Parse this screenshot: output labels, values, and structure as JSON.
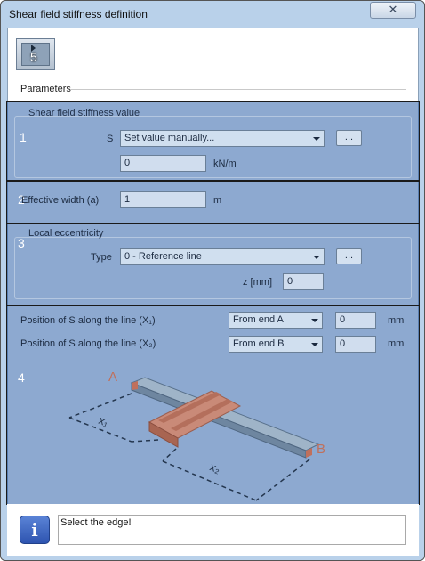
{
  "window": {
    "title": "Shear field stiffness definition",
    "close_glyph": "✕"
  },
  "toolbar": {
    "select_icon": "cursor-arrow-icon",
    "overlay_number": "5"
  },
  "parameters": {
    "label": "Parameters"
  },
  "stiffness": {
    "number": "1",
    "group_title": "Shear field stiffness value",
    "s_label": "S",
    "mode_value": "Set value manually...",
    "dots_label": "...",
    "value": "0",
    "unit": "kN/m"
  },
  "effective_width": {
    "number": "2",
    "label": "Effective width (a)",
    "value": "1",
    "unit": "m"
  },
  "eccentricity": {
    "number": "3",
    "group_title": "Local eccentricity",
    "type_label": "Type",
    "type_value": "0 - Reference line",
    "dots_label": "...",
    "z_label": "z [mm]",
    "z_value": "0"
  },
  "position": {
    "number": "4",
    "x1_label": "Position of S along the line (X₁)",
    "x1_mode": "From end A",
    "x1_value": "0",
    "x1_unit": "mm",
    "x2_label": "Position of S along the line (X₂)",
    "x2_mode": "From end B",
    "x2_value": "0",
    "x2_unit": "mm",
    "diagram": {
      "end_a": "A",
      "end_b": "B",
      "x1": "x₁",
      "x2": "x₂"
    }
  },
  "status": {
    "icon": "info-icon",
    "message": "Select the edge!"
  }
}
